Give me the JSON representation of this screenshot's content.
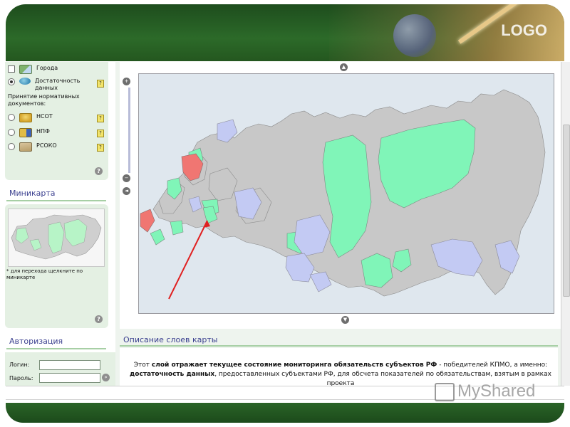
{
  "slide": {
    "logo_text": "LOGO",
    "watermark_text": "MyShared"
  },
  "layers": {
    "items": [
      {
        "label": "Города",
        "control": "checkbox",
        "icon": "city-layer-icon"
      },
      {
        "label": "Достаточность данных",
        "control": "radio-selected",
        "icon": "data-sufficiency-layer-icon"
      }
    ],
    "docs_heading": "Принятие нормативных документов:",
    "doc_items": [
      {
        "label": "НСОТ",
        "control": "radio"
      },
      {
        "label": "НПФ",
        "control": "radio"
      },
      {
        "label": "РСОКО",
        "control": "radio"
      }
    ],
    "help_glyph": "?"
  },
  "minimap": {
    "title": "Миникарта",
    "note": "* для перехода щелкните по миникарте"
  },
  "auth": {
    "title": "Авторизация",
    "login_label": "Логин:",
    "password_label": "Пароль:",
    "go_glyph": "»"
  },
  "description": {
    "title": "Описание слоев карты",
    "parts": {
      "p1": "Этот ",
      "b1": "слой отражает текущее состояние мониторинга обязательств субъектов РФ",
      "p2": " - победителей КПМО, а именно: ",
      "b2": "достаточность данных",
      "p3": ", предоставленных субъектами РФ, для обсчета показателей по обязательствам, взятым в рамках проекта"
    }
  },
  "map": {
    "nav_up": "▲",
    "nav_down": "▼",
    "nav_left": "◄",
    "zoom_in": "+",
    "zoom_out": "−",
    "colors": {
      "background": "#c8d8e6",
      "region_default": "#c8c8c8",
      "region_sufficient": "#80f5b8",
      "region_partial": "#c3caf3",
      "region_insufficient": "#f07672",
      "arrow": "#e02020"
    }
  }
}
